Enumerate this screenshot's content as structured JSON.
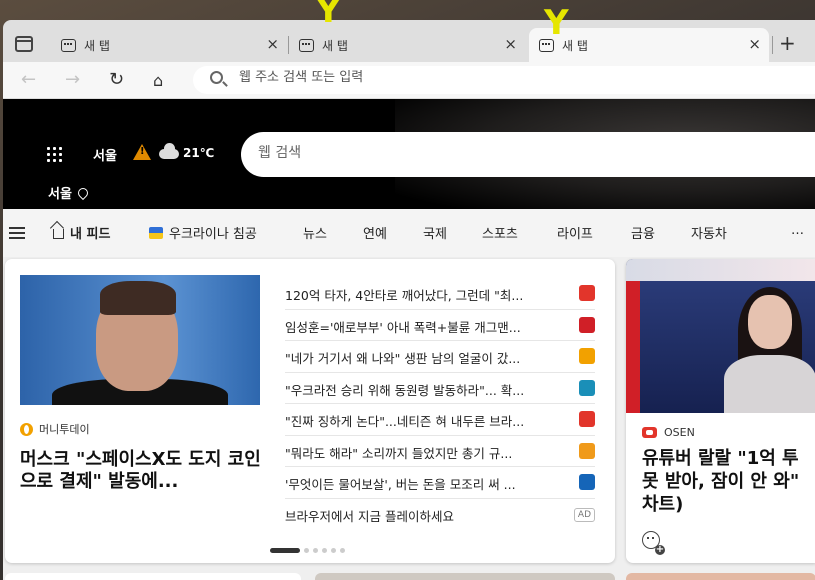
{
  "tabs": [
    {
      "title": "새 탭",
      "close": "×"
    },
    {
      "title": "새 탭",
      "close": "×"
    },
    {
      "title": "새 탭",
      "close": "×"
    }
  ],
  "new_tab": "+",
  "address": {
    "placeholder": "웹 주소 검색 또는 입력"
  },
  "weather": {
    "city": "서울",
    "temp": "21℃",
    "location": "서울"
  },
  "search": {
    "placeholder": "웹 검색"
  },
  "categories": [
    "내 피드",
    "우크라이나 침공",
    "뉴스",
    "연예",
    "국제",
    "스포츠",
    "라이프",
    "금융",
    "자동차",
    "…"
  ],
  "main_story": {
    "source": "머니투데이",
    "headline": "머스크 \"스페이스X도 도지 코인으로 결제\" 발동에..."
  },
  "headlines": [
    {
      "text": "120억 타자, 4안타로 깨어났다, 그런데 \"최...",
      "icon": "red-rounded-logo",
      "color": "#e2352b"
    },
    {
      "text": "임성훈='애로부부' 아내 폭력+불륜 개그맨...",
      "icon": "red-star-logo",
      "color": "#d01f27"
    },
    {
      "text": "\"네가 거기서 왜 나와\" 생판 남의 얼굴이 갔...",
      "icon": "orange-o-logo",
      "color": "#f2a100"
    },
    {
      "text": "\"우크라전 승리 위해 동원령 발동하라\"... 확...",
      "icon": "globe-logo",
      "color": "#1a8fb8"
    },
    {
      "text": "\"진짜 징하게 논다\"...네티즌 혀 내두른 브라...",
      "icon": "j-logo",
      "color": "#e2352b"
    },
    {
      "text": "\"뭐라도 해라\" 소리까지 들었지만 총기 규...",
      "icon": "orange-circle-logo",
      "color": "#f09a1a"
    },
    {
      "text": "'무엇이든 물어보살', 버는 돈을 모조리 써 ...",
      "icon": "fn-logo",
      "color": "#1565b8"
    },
    {
      "text": "브라우저에서 지금 플레이하세요",
      "icon": "ad-badge",
      "ad": "AD"
    }
  ],
  "side_story": {
    "source": "OSEN",
    "headline": "유튜버 랄랄 \"1억 투\n못 받아, 잠이 안 와\"\n차트)"
  },
  "carousel": {
    "total": 6,
    "active": 1
  }
}
